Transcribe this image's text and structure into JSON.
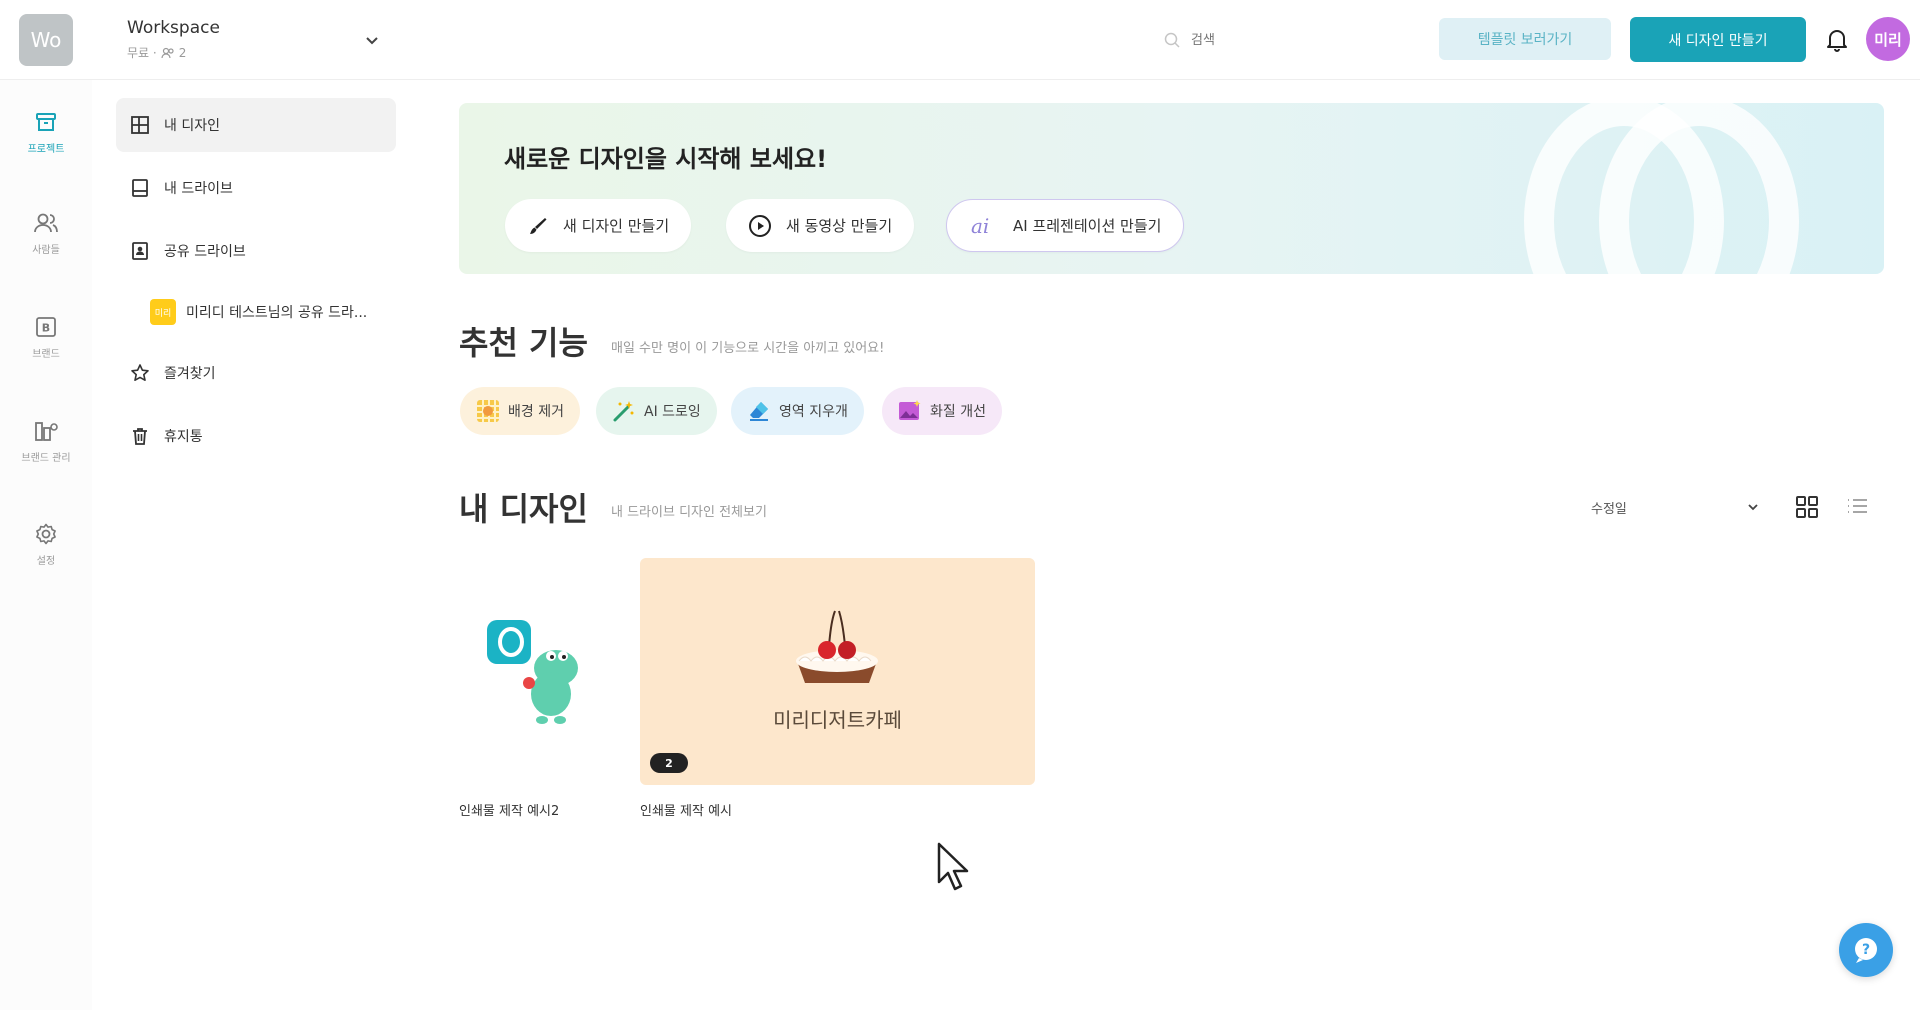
{
  "workspace": {
    "avatar": "Wo",
    "name": "Workspace",
    "plan": "무료 ·",
    "members": "2"
  },
  "search": {
    "placeholder": "검색"
  },
  "header": {
    "templates_label": "템플릿 보러가기",
    "new_design_label": "새 디자인 만들기",
    "user_initials": "미리"
  },
  "rail": {
    "items": [
      {
        "label": "프로젝트",
        "icon": "archive-icon"
      },
      {
        "label": "사람들",
        "icon": "people-icon"
      },
      {
        "label": "브랜드",
        "icon": "brand-icon"
      },
      {
        "label": "브랜드 관리",
        "icon": "brand-manage-icon"
      },
      {
        "label": "설정",
        "icon": "gear-icon"
      }
    ]
  },
  "sidenav": {
    "items": [
      {
        "label": "내 디자인",
        "icon": "grid-icon"
      },
      {
        "label": "내 드라이브",
        "icon": "drive-icon"
      },
      {
        "label": "공유 드라이브",
        "icon": "shared-drive-icon"
      }
    ],
    "shared_sub": {
      "badge": "미리",
      "label": "미리디 테스트님의 공유 드라..."
    },
    "items2": [
      {
        "label": "즐겨찾기",
        "icon": "star-icon"
      },
      {
        "label": "휴지통",
        "icon": "trash-icon"
      }
    ]
  },
  "hero": {
    "title": "새로운 디자인을 시작해 보세요!",
    "buttons": [
      {
        "label": "새 디자인 만들기",
        "icon": "brush-icon"
      },
      {
        "label": "새 동영상 만들기",
        "icon": "play-icon"
      },
      {
        "label": "AI 프레젠테이션 만들기",
        "icon": "ai-icon"
      }
    ]
  },
  "recommended": {
    "title": "추천 기능",
    "subtitle": "매일 수만 명이 이 기능으로 시간을 아끼고 있어요!",
    "chips": [
      {
        "label": "배경 제거",
        "bg": "#fdf1dc"
      },
      {
        "label": "AI 드로잉",
        "bg": "#e6f5ee"
      },
      {
        "label": "영역 지우개",
        "bg": "#e3f2fb"
      },
      {
        "label": "화질 개선",
        "bg": "#f6e8f8"
      }
    ]
  },
  "my_designs": {
    "title": "내 디자인",
    "subtitle": "내 드라이브 디자인 전체보기",
    "sort": "수정일",
    "cards": [
      {
        "name": "인쇄물 제작 예시2"
      },
      {
        "name": "인쇄물 제작 예시",
        "thumb_text": "미리디저트카페",
        "page_count": "2"
      }
    ]
  },
  "colors": {
    "accent": "#1aa3b7",
    "avatar": "#c26ae0",
    "help": "#3aa0e6"
  }
}
